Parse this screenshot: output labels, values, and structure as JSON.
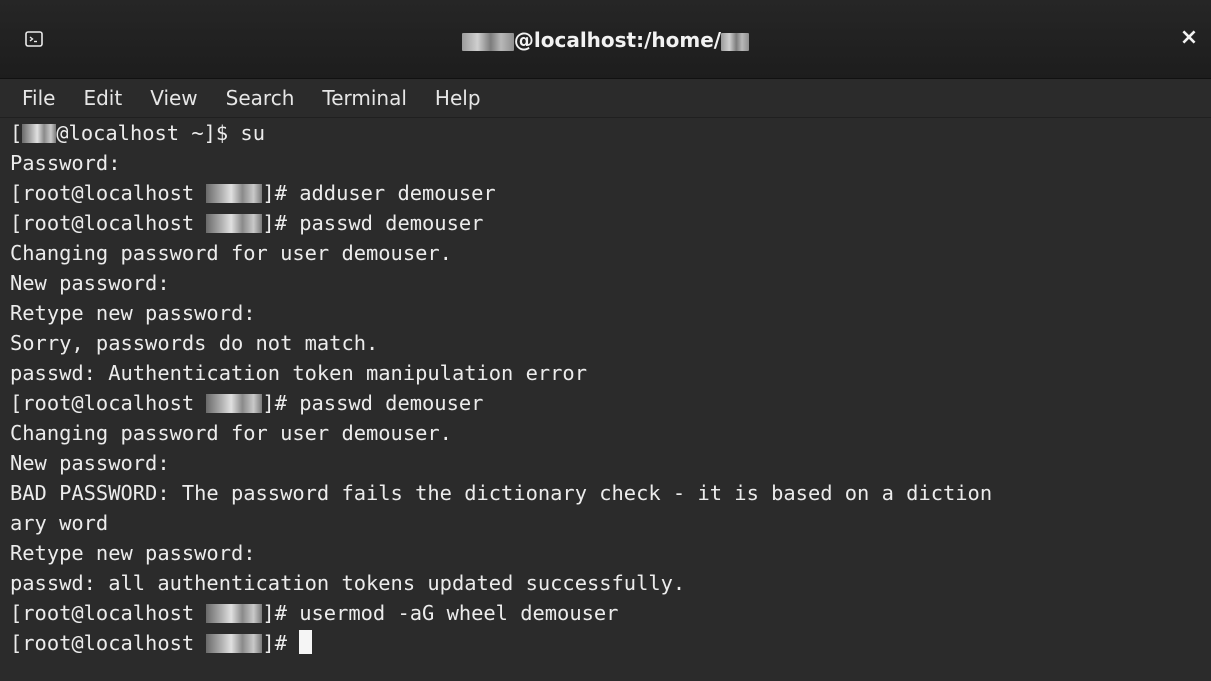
{
  "window": {
    "title_suffix": "@localhost:/home/",
    "close_glyph": "×"
  },
  "menu": [
    {
      "label": "File"
    },
    {
      "label": "Edit"
    },
    {
      "label": "View"
    },
    {
      "label": "Search"
    },
    {
      "label": "Terminal"
    },
    {
      "label": "Help"
    }
  ],
  "terminal": {
    "lines": [
      {
        "pre": "[",
        "post": "@localhost ~]$ su"
      },
      {
        "text": "Password:"
      },
      {
        "pre": "[root@localhost ",
        "post": "]# adduser demouser"
      },
      {
        "pre": "[root@localhost ",
        "post": "]# passwd demouser"
      },
      {
        "text": "Changing password for user demouser."
      },
      {
        "text": "New password:"
      },
      {
        "text": "Retype new password:"
      },
      {
        "text": "Sorry, passwords do not match."
      },
      {
        "text": "passwd: Authentication token manipulation error"
      },
      {
        "pre": "[root@localhost ",
        "post": "]# passwd demouser"
      },
      {
        "text": "Changing password for user demouser."
      },
      {
        "text": "New password:"
      },
      {
        "text": "BAD PASSWORD: The password fails the dictionary check - it is based on a diction"
      },
      {
        "text": "ary word"
      },
      {
        "text": "Retype new password:"
      },
      {
        "text": "passwd: all authentication tokens updated successfully."
      },
      {
        "pre": "[root@localhost ",
        "post": "]# usermod -aG wheel demouser"
      },
      {
        "pre": "[root@localhost ",
        "post": "]# "
      }
    ]
  }
}
